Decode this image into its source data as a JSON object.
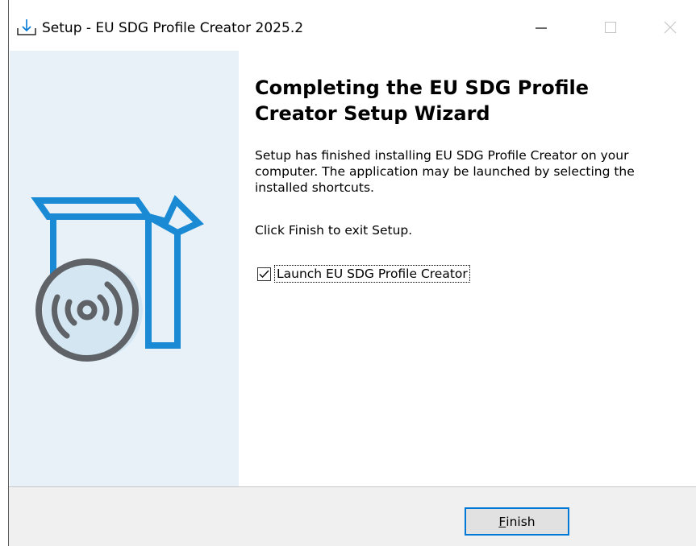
{
  "window": {
    "title": "Setup - EU SDG Profile Creator 2025.2",
    "icon": "setup-download-icon",
    "controls": [
      "minimize-icon",
      "maximize-icon",
      "close-icon"
    ]
  },
  "side_panel": {
    "illustration": "software-box-with-disc-icon",
    "colors": {
      "background": "#e8f1f8",
      "box": "#1a8ad4",
      "disc": "#5f6368"
    }
  },
  "content": {
    "heading": "Completing the EU SDG Profile Creator Setup Wizard",
    "body": "Setup has finished installing EU SDG Profile Creator on your computer. The application may be launched by selecting the installed shortcuts.",
    "exit_text": "Click Finish to exit Setup.",
    "launch_checkbox": {
      "label": "Launch EU SDG Profile Creator",
      "checked": true
    }
  },
  "footer": {
    "finish_button": {
      "mnemonic": "F",
      "rest": "inish"
    }
  },
  "colors": {
    "accent": "#0078d7",
    "footer_bg": "#f0f0f0"
  }
}
